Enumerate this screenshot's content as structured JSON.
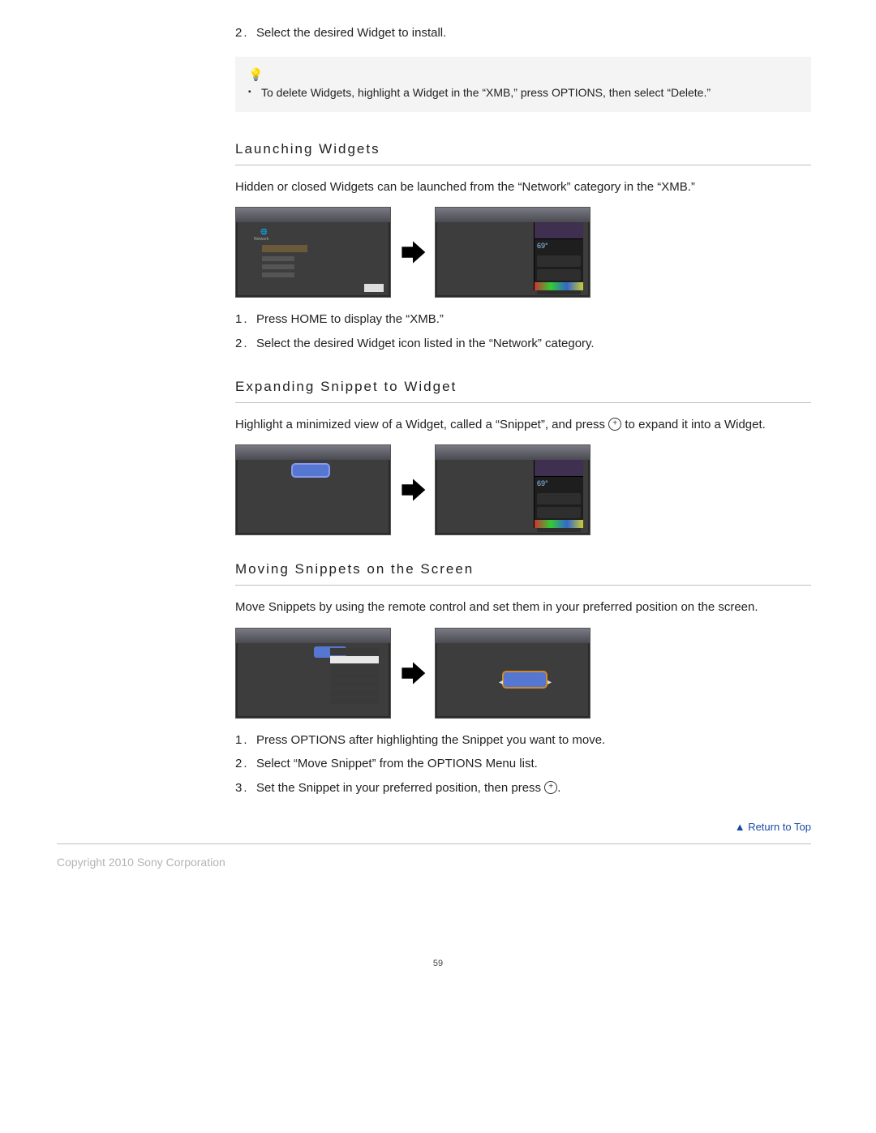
{
  "intro_steps": [
    "Select the desired Widget to install."
  ],
  "tip": {
    "icon_glyph": "💡",
    "items": [
      "To delete Widgets, highlight a Widget in the “XMB,” press OPTIONS, then select “Delete.”"
    ]
  },
  "sections": {
    "launching": {
      "title": "Launching Widgets",
      "body": "Hidden or closed Widgets can be launched from the “Network” category in the “XMB.”",
      "steps": [
        "Press HOME to display the “XMB.”",
        "Select the desired Widget icon listed in the “Network” category."
      ]
    },
    "expanding": {
      "title": "Expanding Snippet to Widget",
      "body_before": "Highlight a minimized view of a Widget, called a “Snippet”, and press ",
      "body_after": " to expand it into a Widget."
    },
    "moving": {
      "title": "Moving Snippets on the Screen",
      "body": "Move Snippets by using the remote control and set them in your preferred position on the screen.",
      "steps": [
        "Press OPTIONS after highlighting the Snippet you want to move.",
        "Select “Move Snippet” from the OPTIONS Menu list.",
        "Set the Snippet in your preferred position, then press "
      ]
    }
  },
  "return_to_top": "Return to Top",
  "copyright": "Copyright 2010 Sony Corporation",
  "page_number": "59"
}
